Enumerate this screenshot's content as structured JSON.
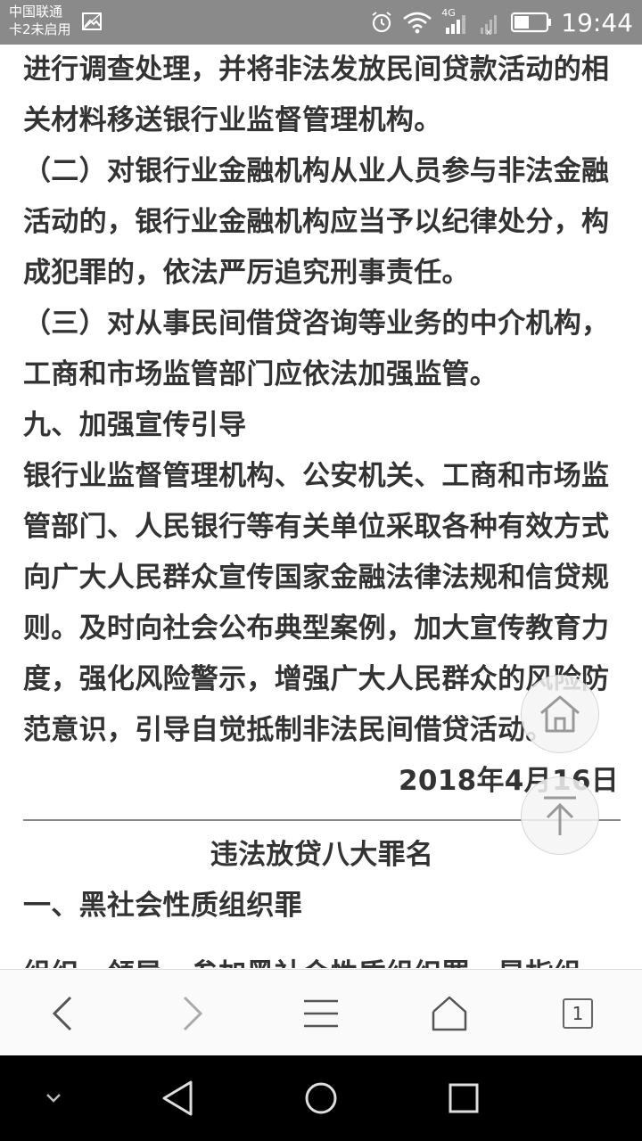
{
  "status_bar": {
    "carrier_line1": "中国联通",
    "carrier_line2": "卡2未启用",
    "network": "4G",
    "time": "19:44"
  },
  "article": {
    "paragraphs": [
      "进行调查处理，并将非法发放民间贷款活动的相关材料移送银行业监督管理机构。",
      "（二）对银行业金融机构从业人员参与非法金融活动的，银行业金融机构应当予以纪律处分，构成犯罪的，依法严厉追究刑事责任。",
      "（三）对从事民间借贷咨询等业务的中介机构，工商和市场监管部门应依法加强监管。",
      "九、加强宣传引导",
      "银行业监督管理机构、公安机关、工商和市场监管部门、人民银行等有关单位采取各种有效方式向广大人民群众宣传国家金融法律法规和信贷规则。及时向社会公布典型案例，加大宣传教育力度，强化风险警示，增强广大人民群众的风险防范意识，引导自觉抵制非法民间借贷活动。"
    ],
    "date": "2018年4月16日",
    "section_title": "违法放贷八大罪名",
    "section_heading": "一、黑社会性质组织罪",
    "section_body": "组织、领导、参加黑社会性质组织罪，是指组"
  },
  "toolbar": {
    "tab_count": "1"
  },
  "icons": {
    "back": "chevron-left-icon",
    "forward": "chevron-right-icon",
    "menu": "menu-icon",
    "home": "home-icon",
    "tabs": "tabs-icon",
    "scroll_top": "arrow-up-icon"
  }
}
